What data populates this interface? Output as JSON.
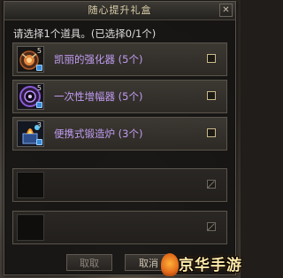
{
  "window": {
    "title": "随心提升礼盒",
    "close_symbol": "✕"
  },
  "prompt": "请选择1个道具。(已选择0/1个)",
  "items": [
    {
      "label": "凯丽的强化器 (5个)",
      "quantity": "5",
      "icon": "enhancer-icon",
      "checked": false
    },
    {
      "label": "一次性增幅器 (5个)",
      "quantity": "5",
      "icon": "amplifier-icon",
      "checked": false
    },
    {
      "label": "便携式锻造炉 (3个)",
      "quantity": "3",
      "icon": "forge-icon",
      "checked": false
    }
  ],
  "buttons": {
    "cancel_left": "取取",
    "cancel_right": "取消"
  },
  "watermark": {
    "text": "京华手游"
  },
  "colors": {
    "item_label": "#c19df3",
    "title_text": "#d9cda9"
  }
}
